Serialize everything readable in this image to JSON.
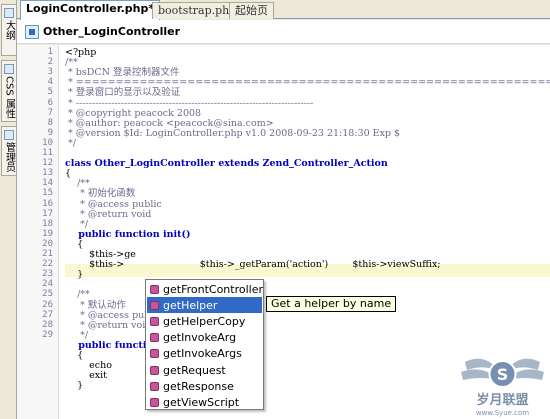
{
  "side_tabs": [
    {
      "label": "大纲",
      "icon": "outline-icon"
    },
    {
      "label": "CSS 属性",
      "icon": "css-properties-icon"
    },
    {
      "label": "管理员",
      "icon": "admin-icon"
    }
  ],
  "editor_tabs": [
    {
      "label": "LoginController.php*",
      "active": true
    },
    {
      "label": "bootstrap.php",
      "active": false
    },
    {
      "label": "起始页",
      "active": false
    }
  ],
  "breadcrumb": "Other_LoginController",
  "line_numbers": [
    "1",
    "2",
    "3",
    "4",
    "5",
    "6",
    "7",
    "8",
    "9",
    "10",
    "11",
    "12",
    "13",
    "14",
    "15",
    "16",
    "17",
    "18",
    "19",
    "20",
    "21",
    "22",
    "23",
    "24",
    "25",
    "26",
    "27",
    "28",
    "29"
  ],
  "code_lines": [
    "<?php",
    "/**",
    " * bsDCN 登录控制器文件",
    " * ==========================================================================",
    " * 登录窗口的显示以及验证",
    " * --------------------------------------------------------------------------",
    " * @copyright peacock 2008",
    " * @author: peacock <peacock@sina.com>",
    " * @version $Id: LoginController.php v1.0 2008-09-23 21:18:30 Exp $",
    " */",
    "",
    "class Other_LoginController extends Zend_Controller_Action",
    "{",
    "    /**",
    "     * 初始化函数",
    "     * @access public",
    "     * @return void",
    "     */",
    "    public function init()",
    "    {",
    "        $this->ge",
    "        $this->                         $this->_getParam('action')        $this->viewSuffix;",
    "    }",
    "",
    "    /**",
    "     * 默认动作",
    "     * @access public",
    "     * @return void",
    "     */",
    "    public function indexAction()",
    "    {",
    "        echo                                  $th",
    "        exit",
    "    }"
  ],
  "autocomplete": {
    "items": [
      "getFrontController",
      "getHelper",
      "getHelperCopy",
      "getInvokeArg",
      "getInvokeArgs",
      "getRequest",
      "getResponse",
      "getViewScript"
    ],
    "selected_index": 1,
    "tooltip": "Get a helper by name"
  },
  "watermark": {
    "text": "岁月联盟",
    "url": "www.Syue.com"
  },
  "colors": {
    "keyword": "#0000c0",
    "comment": "#6a6a8e",
    "string": "#c00000",
    "selection": "#3169c6",
    "method_icon": "#c6589a"
  }
}
